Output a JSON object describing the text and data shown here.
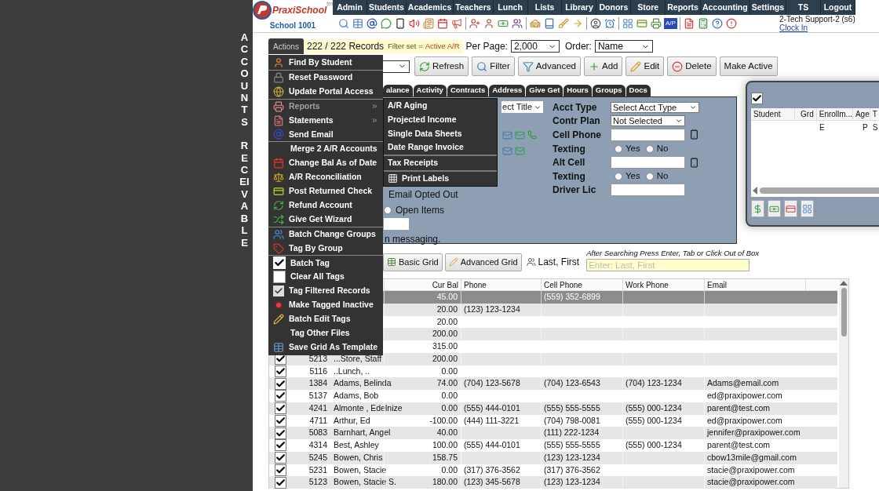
{
  "page_title": {
    "words": [
      "ACCOUNTS",
      "RECEIVABLE"
    ]
  },
  "logo": {
    "name": "PraxiSchool",
    "mark": "tm",
    "school": "School 1001"
  },
  "nav": [
    "Admin",
    "Students",
    "Academics",
    "Teachers",
    "Lunch",
    "Lists",
    "Library",
    "Donors",
    "Store",
    "Reports",
    "Accounting",
    "Settings",
    "TS",
    "Logout"
  ],
  "toolbar": {
    "ap_badge": "A/P"
  },
  "user": {
    "name": "2-Tech Support-2 (s6)",
    "clock_link": "Clock In"
  },
  "actions_menu": {
    "label": "Actions",
    "groups": [
      [
        {
          "label": "Find By Student"
        }
      ],
      [
        {
          "label": "Reset Password"
        },
        {
          "label": "Update Portal Access"
        }
      ],
      [
        {
          "label": "Reports",
          "expanded": true
        },
        {
          "label": "Statements",
          "expanded": false
        },
        {
          "label": "Send Email"
        }
      ],
      [
        {
          "label": "Merge 2 A/R Accounts"
        },
        {
          "label": "Change Bal As of Date"
        },
        {
          "label": "A/R Reconciliation"
        },
        {
          "label": "Post Returned Check"
        },
        {
          "label": "Refund Account"
        },
        {
          "label": "Give Get Wizard"
        }
      ],
      [
        {
          "label": "Batch Change Groups"
        },
        {
          "label": "Tag By Group"
        }
      ],
      [
        {
          "label": "Batch Tag"
        },
        {
          "label": "Clear All Tags"
        },
        {
          "label": "Tag Filtered Records"
        },
        {
          "label": "Make Tagged Inactive"
        },
        {
          "label": "Batch Edit Tags"
        },
        {
          "label": "Tag Other Files"
        },
        {
          "label": "Save Grid As Template"
        }
      ]
    ]
  },
  "reports_submenu": [
    [
      "A/R Aging",
      "Projected Income",
      "Single Data Sheets",
      "Date Range Invoice"
    ],
    [
      "Tax Receipts"
    ],
    [
      "Print Labels"
    ]
  ],
  "records": {
    "count": "222 / 222 Records",
    "filter_label": "Filter set =",
    "filter_value": "Active A/R"
  },
  "per_page": {
    "label": "Per Page:",
    "value": "2,000"
  },
  "order": {
    "label": "Order:",
    "value": "Name"
  },
  "buttons": [
    "Refresh",
    "Filter",
    "Advanced",
    "Add",
    "Edit",
    "Delete",
    "Make Active"
  ],
  "tabs": [
    "alance",
    "Activity",
    "Contracts",
    "Address",
    "Give Get",
    "Hours",
    "Groups",
    "Docs"
  ],
  "form": {
    "title_select": "ect Title",
    "email_opted_out": "Email Opted Out",
    "open_items": {
      "label": "Open Items",
      "selected": false
    },
    "messaging_note": "n messaging.",
    "fields": [
      {
        "kind": "select",
        "label": "Acct Type",
        "value": "Select Acct Type"
      },
      {
        "kind": "select",
        "label": "Contr Plan",
        "value": "Not Selected"
      },
      {
        "kind": "phone",
        "label": "Cell Phone"
      },
      {
        "kind": "radio",
        "label": "Texting",
        "options": [
          {
            "label": "Yes",
            "selected": false
          },
          {
            "label": "No",
            "selected": false
          }
        ]
      },
      {
        "kind": "phone",
        "label": "Alt Cell"
      },
      {
        "kind": "radio",
        "label": "Texting",
        "options": [
          {
            "label": "Yes",
            "selected": false
          },
          {
            "label": "No",
            "selected": false
          }
        ]
      },
      {
        "kind": "text",
        "label": "Driver Lic"
      }
    ]
  },
  "grid_buttons": [
    "Basic Grid",
    "Advanced Grid"
  ],
  "sort": "Last, First",
  "search": {
    "hint": "After Searching Press Enter, Tab or Click Out of Box",
    "placeholder": "Enter: Last, First"
  },
  "grid": {
    "columns": [
      "Cur Bal",
      "Phone",
      "Cell Phone",
      "Work Phone",
      "Email"
    ],
    "rows": [
      {
        "selected": true,
        "cur_bal": "45.00",
        "cell_phone": "(559) 352-6899"
      },
      {
        "selected": false,
        "cur_bal": "20.00",
        "phone": "(123) 123-1234"
      },
      {
        "selected": false,
        "cur_bal": "20.00"
      },
      {
        "selected": false,
        "cur_bal": "200.00"
      },
      {
        "selected": false,
        "cur_bal": "315.00"
      },
      {
        "selected": false,
        "tagged": true,
        "id": "5213",
        "name": "...Store, Staff",
        "cur_bal": "200.00"
      },
      {
        "selected": false,
        "tagged": true,
        "id": "5116",
        "name": "..Lunch, ..",
        "cur_bal": "0.00"
      },
      {
        "selected": false,
        "tagged": true,
        "id": "1384",
        "name": "Adams, Belinda",
        "cur_bal": "74.00",
        "phone": "(704) 123-5678",
        "cell_phone": "(704) 123-6543",
        "work_phone": "(704) 123-1234",
        "email": "Adams@email.com"
      },
      {
        "selected": false,
        "tagged": true,
        "id": "5137",
        "name": "Adams, Bob",
        "cur_bal": "0.00",
        "email": "ed@praxipower.com"
      },
      {
        "selected": false,
        "tagged": true,
        "id": "4241",
        "name": "Almonte , Edelnize",
        "cur_bal": "0.00",
        "phone": "(555) 444-0101",
        "cell_phone": "(555) 555-5555",
        "work_phone": "(555) 000-1234",
        "email": "parent@test.com"
      },
      {
        "selected": false,
        "tagged": true,
        "id": "4711",
        "name": "Arthur, Ed",
        "cur_bal": "-100.00",
        "phone": "(444) 111-3221",
        "cell_phone": "(704) 798-0081",
        "work_phone": "(555) 000-1234",
        "email": "ed@praxipower.com"
      },
      {
        "selected": false,
        "tagged": true,
        "id": "5083",
        "name": "Barnhart, Angel",
        "cur_bal": "40.00",
        "cell_phone": "(111) 222-1234",
        "email": "jennifer@praxipower.com"
      },
      {
        "selected": false,
        "tagged": true,
        "id": "4314",
        "name": "Best, Ashley",
        "cur_bal": "100.00",
        "phone": "(555) 444-0101",
        "cell_phone": "(555) 555-5555",
        "work_phone": "(555) 000-1234",
        "email": "parent@test.com"
      },
      {
        "selected": false,
        "tagged": true,
        "id": "5245",
        "name": "Bowen, Chris",
        "cur_bal": "158.75",
        "cell_phone": "(123) 123-1234",
        "email": "cbow13mile@gmail.com"
      },
      {
        "selected": false,
        "tagged": true,
        "id": "5231",
        "name": "Bowen, Stacie",
        "cur_bal": "0.00",
        "phone": "(317) 376-3562",
        "cell_phone": "(317) 376-3562",
        "email": "stacie@praxipower.com"
      },
      {
        "selected": false,
        "tagged": true,
        "id": "5123",
        "name": "Bowen, Stacie S.",
        "cur_bal": "180.00",
        "phone": "(123) 345-5678",
        "cell_phone": "(123) 123-1234",
        "email": "stacie@praxipower.com"
      }
    ]
  },
  "side_panel": {
    "checked": true,
    "columns": [
      "Student",
      "Grd",
      "Enrollm...",
      "Age",
      "T"
    ],
    "rows": [
      {
        "enrollment": "E",
        "age": "P",
        "column_5": "S"
      }
    ]
  }
}
